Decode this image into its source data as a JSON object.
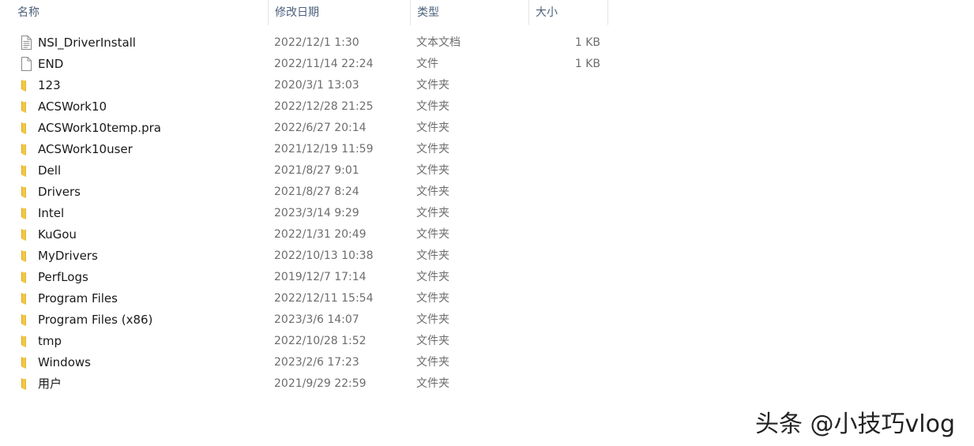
{
  "header": {
    "name": "名称",
    "modified": "修改日期",
    "type": "类型",
    "size": "大小",
    "sort_caret": "ˇ"
  },
  "files": [
    {
      "name": "NSI_DriverInstall",
      "modified": "2022/12/1 1:30",
      "type": "文本文档",
      "size": "1 KB",
      "icon": "text-file-icon"
    },
    {
      "name": "END",
      "modified": "2022/11/14 22:24",
      "type": "文件",
      "size": "1 KB",
      "icon": "file-icon"
    },
    {
      "name": "123",
      "modified": "2020/3/1 13:03",
      "type": "文件夹",
      "size": "",
      "icon": "folder-icon"
    },
    {
      "name": "ACSWork10",
      "modified": "2022/12/28 21:25",
      "type": "文件夹",
      "size": "",
      "icon": "folder-icon"
    },
    {
      "name": "ACSWork10temp.pra",
      "modified": "2022/6/27 20:14",
      "type": "文件夹",
      "size": "",
      "icon": "folder-icon"
    },
    {
      "name": "ACSWork10user",
      "modified": "2021/12/19 11:59",
      "type": "文件夹",
      "size": "",
      "icon": "folder-icon"
    },
    {
      "name": "Dell",
      "modified": "2021/8/27 9:01",
      "type": "文件夹",
      "size": "",
      "icon": "folder-icon"
    },
    {
      "name": "Drivers",
      "modified": "2021/8/27 8:24",
      "type": "文件夹",
      "size": "",
      "icon": "folder-icon"
    },
    {
      "name": "Intel",
      "modified": "2023/3/14 9:29",
      "type": "文件夹",
      "size": "",
      "icon": "folder-icon"
    },
    {
      "name": "KuGou",
      "modified": "2022/1/31 20:49",
      "type": "文件夹",
      "size": "",
      "icon": "folder-icon"
    },
    {
      "name": "MyDrivers",
      "modified": "2022/10/13 10:38",
      "type": "文件夹",
      "size": "",
      "icon": "folder-icon"
    },
    {
      "name": "PerfLogs",
      "modified": "2019/12/7 17:14",
      "type": "文件夹",
      "size": "",
      "icon": "folder-icon"
    },
    {
      "name": "Program Files",
      "modified": "2022/12/11 15:54",
      "type": "文件夹",
      "size": "",
      "icon": "folder-icon"
    },
    {
      "name": "Program Files (x86)",
      "modified": "2023/3/6 14:07",
      "type": "文件夹",
      "size": "",
      "icon": "folder-icon"
    },
    {
      "name": "tmp",
      "modified": "2022/10/28 1:52",
      "type": "文件夹",
      "size": "",
      "icon": "folder-icon"
    },
    {
      "name": "Windows",
      "modified": "2023/2/6 17:23",
      "type": "文件夹",
      "size": "",
      "icon": "folder-icon"
    },
    {
      "name": "用户",
      "modified": "2021/9/29 22:59",
      "type": "文件夹",
      "size": "",
      "icon": "folder-icon"
    }
  ],
  "watermark": "头条 @小技巧vlog",
  "colors": {
    "folder": "#f2c744",
    "folder_dark": "#dba92c",
    "header_text": "#4c607a",
    "meta_text": "#6d6d6d"
  }
}
